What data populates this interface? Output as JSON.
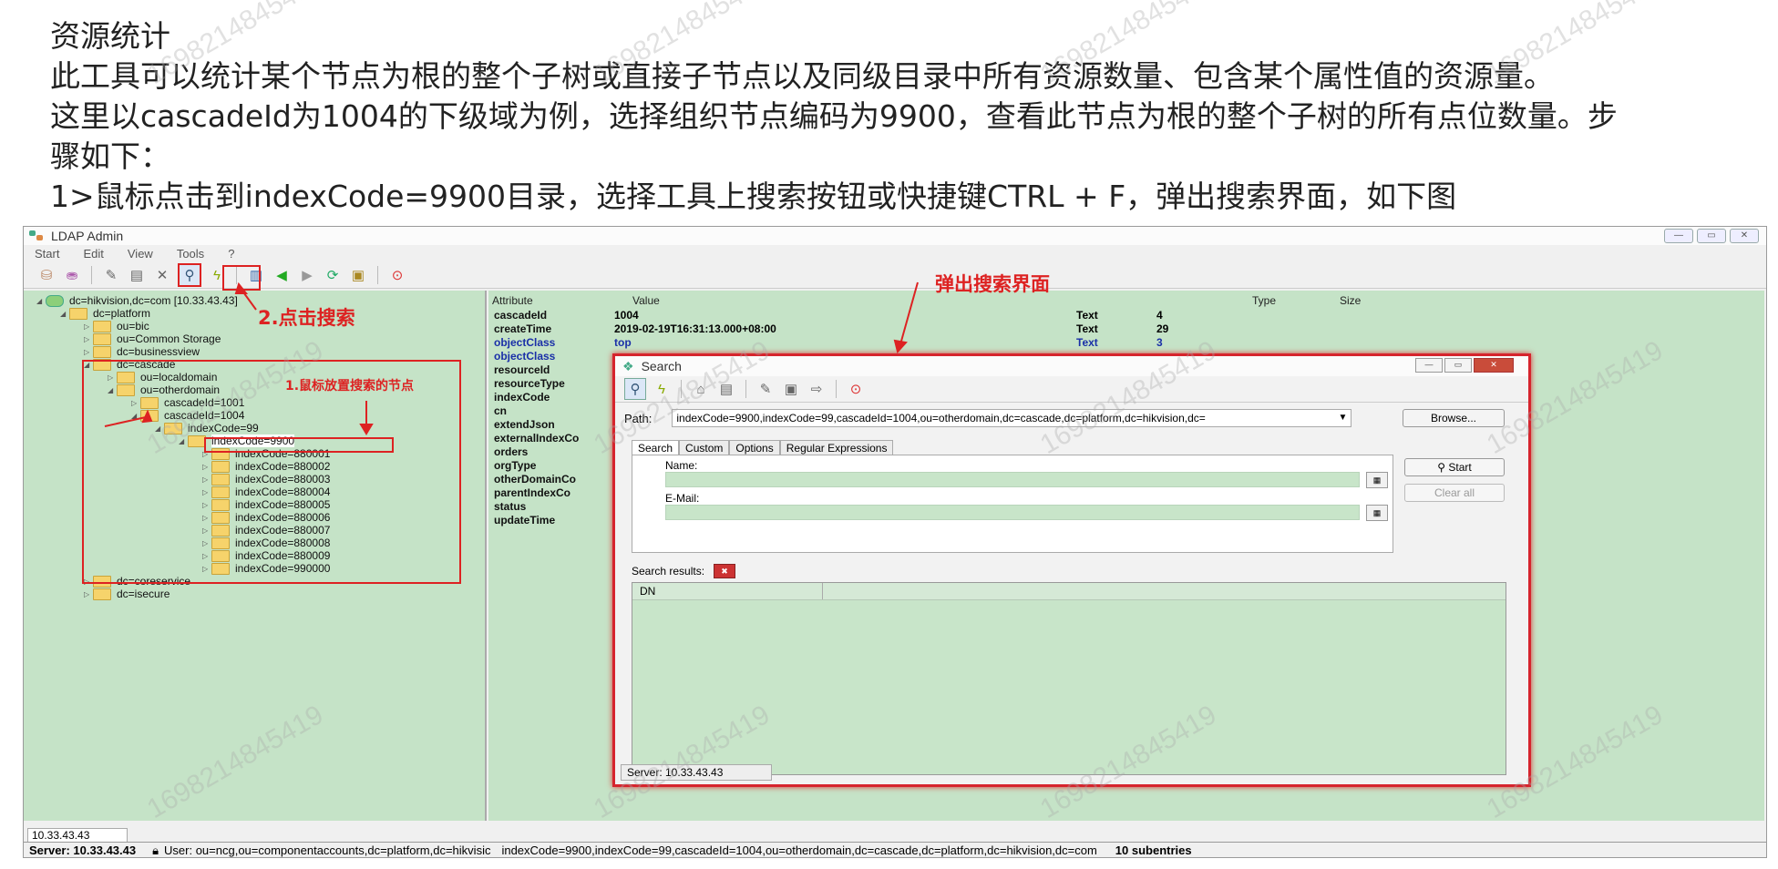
{
  "doc": {
    "heading": "资源统计",
    "line1": "此工具可以统计某个节点为根的整个子树或直接子节点以及同级目录中所有资源数量、包含某个属性值的资源量。",
    "line2": "这里以cascadeId为1004的下级域为例，选择组织节点编码为9900，查看此节点为根的整个子树的所有点位数量。步",
    "line3": "骤如下：",
    "line4": "1>鼠标点击到indexCode=9900目录，选择工具上搜索按钮或快捷键CTRL + F，弹出搜索界面，如下图"
  },
  "watermark": "1698214845419",
  "app": {
    "title": "LDAP Admin",
    "menu": [
      "Start",
      "Edit",
      "View",
      "Tools",
      "?"
    ],
    "tree": [
      {
        "label": "dc=hikvision,dc=com [10.33.43.43]",
        "depth": 0
      },
      {
        "label": "dc=platform",
        "depth": 1
      },
      {
        "label": "ou=bic",
        "depth": 2
      },
      {
        "label": "ou=Common Storage",
        "depth": 2
      },
      {
        "label": "dc=businessview",
        "depth": 2
      },
      {
        "label": "dc=cascade",
        "depth": 2
      },
      {
        "label": "ou=localdomain",
        "depth": 3
      },
      {
        "label": "ou=otherdomain",
        "depth": 3
      },
      {
        "label": "cascadeId=1001",
        "depth": 4
      },
      {
        "label": "cascadeId=1004",
        "depth": 4
      },
      {
        "label": "indexCode=99",
        "depth": 5
      },
      {
        "label": "indexCode=9900",
        "depth": 6
      },
      {
        "label": "indexCode=880001",
        "depth": 7
      },
      {
        "label": "indexCode=880002",
        "depth": 7
      },
      {
        "label": "indexCode=880003",
        "depth": 7
      },
      {
        "label": "indexCode=880004",
        "depth": 7
      },
      {
        "label": "indexCode=880005",
        "depth": 7
      },
      {
        "label": "indexCode=880006",
        "depth": 7
      },
      {
        "label": "indexCode=880007",
        "depth": 7
      },
      {
        "label": "indexCode=880008",
        "depth": 7
      },
      {
        "label": "indexCode=880009",
        "depth": 7
      },
      {
        "label": "indexCode=990000",
        "depth": 7
      },
      {
        "label": "dc=coreservice",
        "depth": 2
      },
      {
        "label": "dc=isecure",
        "depth": 2
      }
    ],
    "attr_headers": {
      "attribute": "Attribute",
      "value": "Value",
      "type": "Type",
      "size": "Size"
    },
    "attrs": [
      {
        "k": "cascadeId",
        "v": "1004",
        "t": "Text",
        "s": "4"
      },
      {
        "k": "createTime",
        "v": "2019-02-19T16:31:13.000+08:00",
        "t": "Text",
        "s": "29"
      },
      {
        "k": "objectClass",
        "v": "top",
        "t": "Text",
        "s": "3"
      },
      {
        "k": "objectClass",
        "v": "",
        "t": "",
        "s": ""
      },
      {
        "k": "resourceId",
        "v": "",
        "t": "",
        "s": ""
      },
      {
        "k": "resourceType",
        "v": "",
        "t": "",
        "s": ""
      },
      {
        "k": "indexCode",
        "v": "",
        "t": "",
        "s": ""
      },
      {
        "k": "cn",
        "v": "",
        "t": "",
        "s": ""
      },
      {
        "k": "extendJson",
        "v": "",
        "t": "",
        "s": ""
      },
      {
        "k": "externalIndexCo",
        "v": "",
        "t": "",
        "s": ""
      },
      {
        "k": "orders",
        "v": "",
        "t": "",
        "s": ""
      },
      {
        "k": "orgType",
        "v": "",
        "t": "",
        "s": ""
      },
      {
        "k": "otherDomainCo",
        "v": "",
        "t": "",
        "s": ""
      },
      {
        "k": "parentIndexCo",
        "v": "",
        "t": "",
        "s": ""
      },
      {
        "k": "status",
        "v": "",
        "t": "",
        "s": ""
      },
      {
        "k": "updateTime",
        "v": "",
        "t": "",
        "s": ""
      }
    ],
    "server_tab": "10.33.43.43",
    "status": {
      "server": "Server: 10.33.43.43",
      "user": "User: ou=ncg,ou=componentaccounts,dc=platform,dc=hikvisic",
      "dn": "indexCode=9900,indexCode=99,cascadeId=1004,ou=otherdomain,dc=cascade,dc=platform,dc=hikvision,dc=com",
      "subentries": "10 subentries"
    }
  },
  "annotations": {
    "step2": "2.点击搜索",
    "step1": "1.鼠标放置搜索的节点",
    "popup": "弹出搜索界面"
  },
  "search_dialog": {
    "title": "Search",
    "path_label": "Path:",
    "path_value": "indexCode=9900,indexCode=99,cascadeId=1004,ou=otherdomain,dc=cascade,dc=platform,dc=hikvision,dc=",
    "browse": "Browse...",
    "tabs": [
      "Search",
      "Custom",
      "Options",
      "Regular Expressions"
    ],
    "name_label": "Name:",
    "email_label": "E-Mail:",
    "start": "Start",
    "clear": "Clear all",
    "results_label": "Search results:",
    "dn_header": "DN",
    "server": "Server: 10.33.43.43"
  },
  "colors": {
    "tree_bg": "#c5e3c7",
    "accent_red": "#d22222",
    "objectclass_blue": "#1a2fa8"
  }
}
